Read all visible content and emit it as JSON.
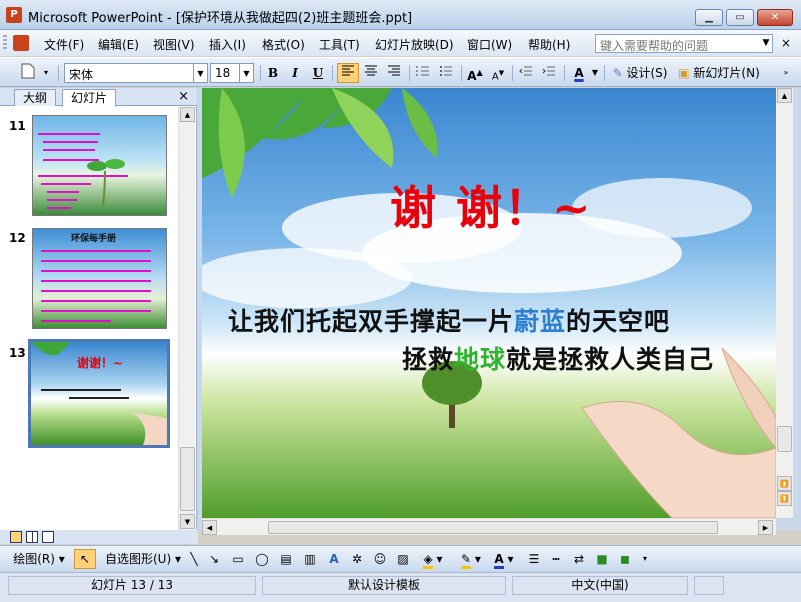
{
  "window": {
    "title": "Microsoft PowerPoint - [保护环境从我做起四(2)班主题班会.ppt]",
    "app_icon_letter": "P",
    "minimize_icon": "minimize-icon",
    "maximize_icon": "restore-icon",
    "close_icon": "close-icon"
  },
  "menu": {
    "items": [
      "文件(F)",
      "编辑(E)",
      "视图(V)",
      "插入(I)",
      "格式(O)",
      "工具(T)",
      "幻灯片放映(D)",
      "窗口(W)",
      "帮助(H)"
    ],
    "help_placeholder": "键入需要帮助的问题",
    "close_doc": "×"
  },
  "toolbar": {
    "font_name": "宋体",
    "font_size": "18",
    "bold": "B",
    "italic": "I",
    "underline": "U",
    "design_label": "设计(S)",
    "new_slide_label": "新幻灯片(N)"
  },
  "left_panel": {
    "tabs": [
      "大纲",
      "幻灯片"
    ],
    "selected_tab": "幻灯片",
    "close": "×",
    "thumbnails": [
      {
        "number": "11",
        "selected": false
      },
      {
        "number": "12",
        "selected": false,
        "heading": "环保每手册"
      },
      {
        "number": "13",
        "selected": true,
        "heading": "谢谢！~"
      }
    ]
  },
  "slide": {
    "thanks_text": "谢 谢！~",
    "line1_parts": [
      "让我们托起双手撑起一片",
      "蔚蓝",
      "的天空吧"
    ],
    "line2_parts": [
      "拯救",
      "地球",
      "就是拯救人类自己"
    ],
    "colors": {
      "thanks": "#e8000a",
      "highlight_blue": "#2f7fd0",
      "highlight_green": "#2db32d",
      "text_dark": "#111111"
    }
  },
  "drawing_toolbar": {
    "draw_label": "绘图(R)",
    "autoshapes_label": "自选图形(U)"
  },
  "status": {
    "slide_position": "幻灯片 13 / 13",
    "template": "默认设计模板",
    "language": "中文(中国)"
  }
}
